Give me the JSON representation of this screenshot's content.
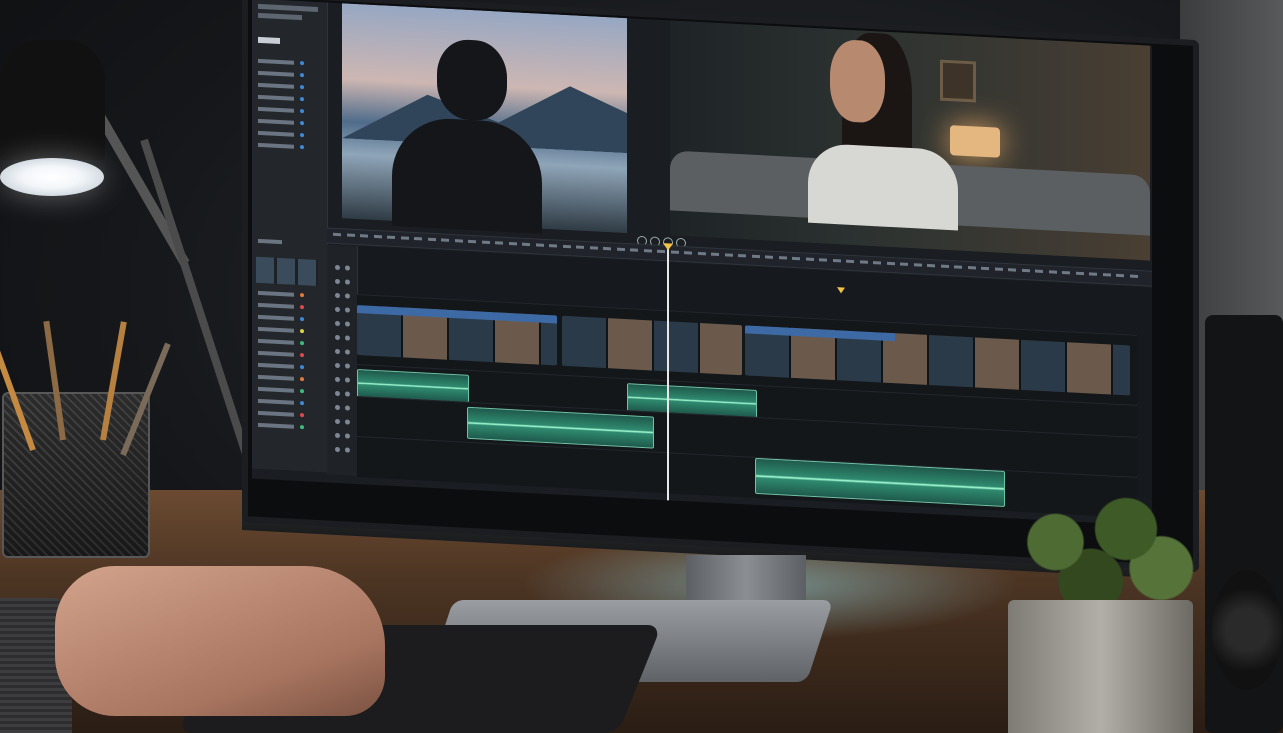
{
  "app": {
    "name": "Video Editor",
    "theme": {
      "background": "#1a1d21",
      "accent": "#3d6aa4",
      "audio": "#2f8a6f",
      "playhead": "#f0c24a"
    }
  },
  "media_panel": {
    "bin_colors": [
      "#3d8bd6",
      "#3d8bd6",
      "#3d8bd6",
      "#3d8bd6",
      "#3d8bd6",
      "#3d8bd6",
      "#3d8bd6",
      "#3d8bd6"
    ],
    "effect_colors": [
      "#e07b39",
      "#d94b4b",
      "#3d8bd6",
      "#d9d14b",
      "#3dbd7d",
      "#d94b4b",
      "#3d8bd6",
      "#e07b39",
      "#3dbd7d",
      "#3d8bd6",
      "#d94b4b",
      "#3dbd7d"
    ]
  },
  "viewers": {
    "source": {
      "content": "lake-silhouette-frame"
    },
    "program": {
      "content": "woman-on-sofa-frame"
    }
  },
  "transport": {
    "icons": [
      "rewind-icon",
      "play-icon",
      "forward-icon",
      "loop-icon"
    ]
  },
  "timeline": {
    "playhead_fraction": 0.39,
    "marker_fraction": 0.62,
    "tracks": [
      "video-1",
      "audio-1",
      "audio-2",
      "audio-3"
    ]
  }
}
